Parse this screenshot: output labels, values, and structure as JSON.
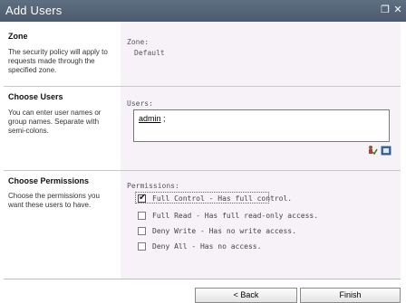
{
  "window": {
    "title": "Add Users",
    "restore_glyph": "❐",
    "close_glyph": "✕"
  },
  "zone": {
    "heading": "Zone",
    "description": "The security policy will apply to requests made through the specified zone.",
    "field_label": "Zone:",
    "value": "Default"
  },
  "users": {
    "heading": "Choose Users",
    "description": "You can enter user names or group names. Separate with semi-colons.",
    "field_label": "Users:",
    "entered_name": "admin",
    "separator": " ;",
    "icons": [
      "check-names-icon",
      "browse-directory-icon"
    ]
  },
  "permissions": {
    "heading": "Choose Permissions",
    "description": "Choose the permissions you want these users to have.",
    "field_label": "Permissions:",
    "options": [
      {
        "label": "Full Control - Has full control.",
        "checked": true
      },
      {
        "label": "Full Read - Has full read-only access.",
        "checked": false
      },
      {
        "label": "Deny Write - Has no write access.",
        "checked": false
      },
      {
        "label": "Deny All - Has no access.",
        "checked": false
      }
    ]
  },
  "footer": {
    "back_label": "< Back",
    "finish_label": "Finish"
  },
  "colors": {
    "titlebar": "#56667a",
    "panel_background": "#f6f2f8"
  }
}
